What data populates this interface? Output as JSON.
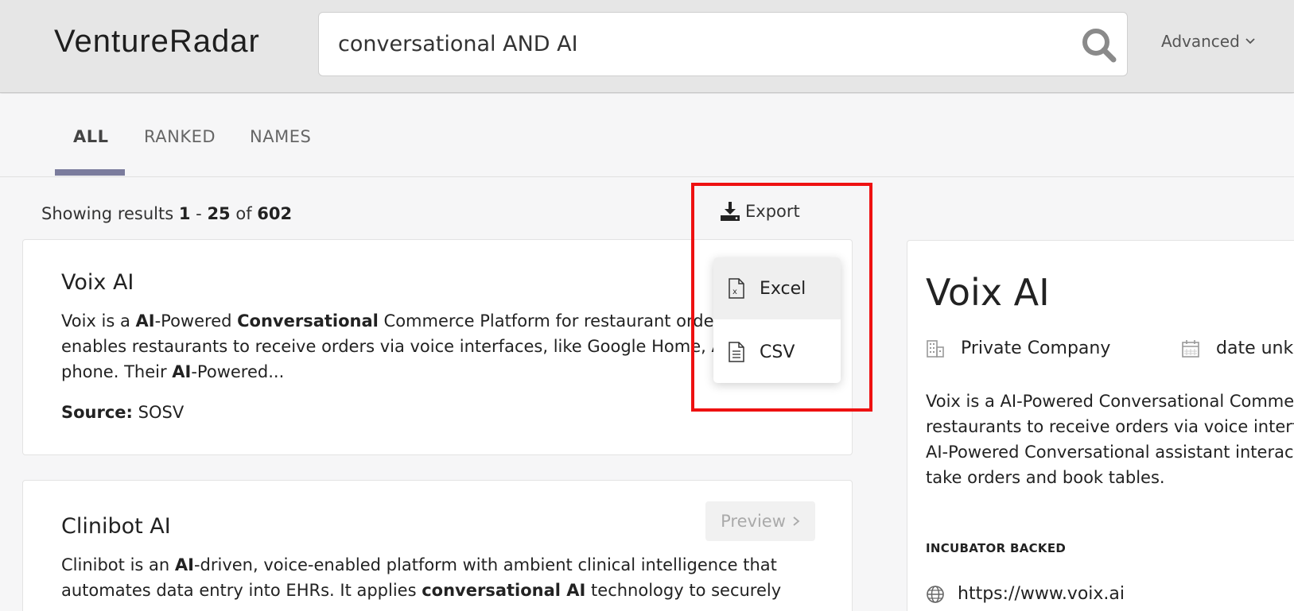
{
  "header": {
    "logo": "VentureRadar",
    "search_value": "conversational AND AI",
    "advanced_label": "Advanced"
  },
  "tabs": [
    {
      "label": "ALL",
      "active": true
    },
    {
      "label": "RANKED",
      "active": false
    },
    {
      "label": "NAMES",
      "active": false
    }
  ],
  "results": {
    "prefix": "Showing results",
    "start": "1",
    "sep": "-",
    "end": "25",
    "of": "of",
    "total": "602"
  },
  "export": {
    "label": "Export",
    "options": [
      "Excel",
      "CSV"
    ]
  },
  "cards": [
    {
      "title": "Voix AI",
      "desc_lines": [
        [
          "Voix is a ",
          "AI",
          "-Powered ",
          "Conversational",
          " Commerce Platform for restaurant ordering"
        ],
        [
          "enables restaurants to receive orders via voice interfaces, like Google Home, Alexa"
        ],
        [
          "phone. Their ",
          "AI",
          "-Powered..."
        ]
      ],
      "source_label": "Source:",
      "source_value": "SOSV"
    },
    {
      "title": "Clinibot AI",
      "preview_label": "Preview",
      "desc_line1_a": "Clinibot is an ",
      "desc_line1_b": "AI",
      "desc_line1_c": "-driven, voice-enabled platform with ambient clinical intelligence that",
      "desc_line2_a": "automates data entry into EHRs. It applies ",
      "desc_line2_b": "conversational AI",
      "desc_line2_c": " technology to securely"
    }
  ],
  "detail": {
    "title": "Voix AI",
    "company_type": "Private Company",
    "date": "date unkno",
    "desc_lines": [
      "Voix is a AI-Powered Conversational Commerce",
      "restaurants to receive orders via voice interfac",
      "AI-Powered Conversational assistant interacts",
      "take orders and book tables."
    ],
    "label": "INCUBATOR BACKED",
    "url": "https://www.voix.ai"
  },
  "colors": {
    "tab_underline": "#7b7c9d",
    "highlight": "#ee1111"
  }
}
